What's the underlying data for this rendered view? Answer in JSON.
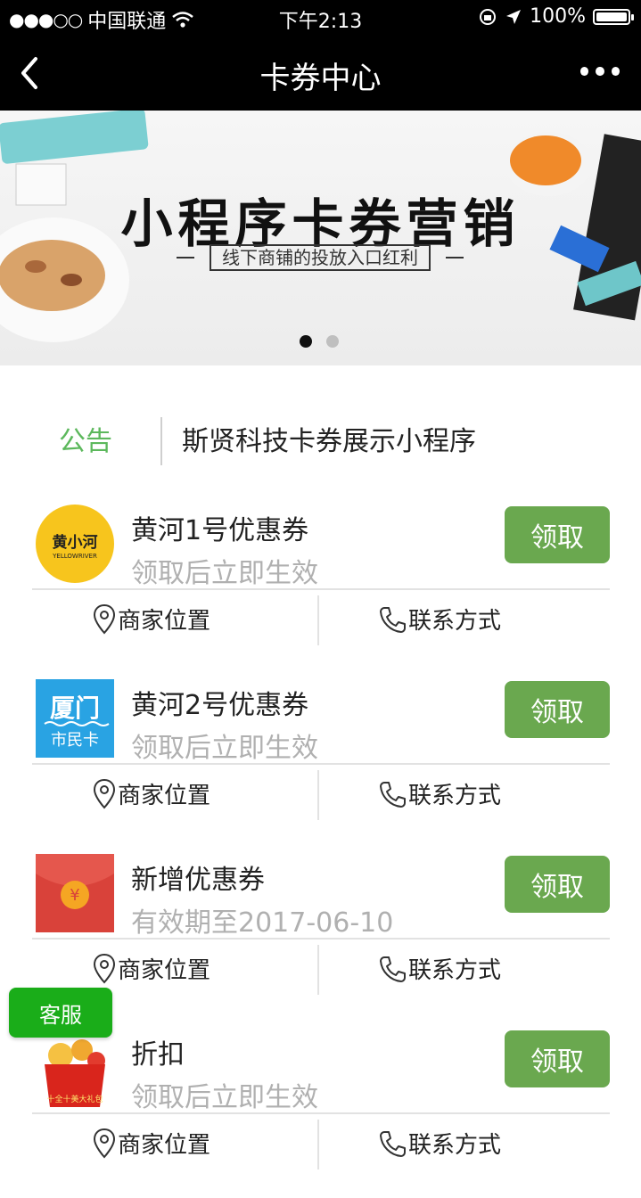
{
  "status_bar": {
    "carrier": "中国联通",
    "signal": "●●●○○",
    "time": "下午2:13",
    "battery": "100%"
  },
  "nav": {
    "title": "卡券中心"
  },
  "banner": {
    "title": "小程序卡券营销",
    "subtitle": "线下商铺的投放入口红利",
    "dots": 2,
    "active_dot": 0
  },
  "notice": {
    "label": "公告",
    "text": "斯贤科技卡券展示小程序"
  },
  "coupons": [
    {
      "name": "黄河1号优惠券",
      "desc": "领取后立即生效",
      "button": "领取",
      "location_label": "商家位置",
      "contact_label": "联系方式",
      "logo": "yellowriver-logo",
      "logo_text": "黄小河",
      "logo_subtext": "YELLOWRIVER"
    },
    {
      "name": "黄河2号优惠券",
      "desc": "领取后立即生效",
      "button": "领取",
      "location_label": "商家位置",
      "contact_label": "联系方式",
      "logo": "xiamen-card-logo",
      "logo_text": "厦门",
      "logo_subtext": "市民卡"
    },
    {
      "name": "新增优惠券",
      "desc": "有效期至2017-06-10",
      "button": "领取",
      "location_label": "商家位置",
      "contact_label": "联系方式",
      "logo": "red-envelope-logo",
      "logo_text": "¥",
      "logo_subtext": ""
    },
    {
      "name": "折扣",
      "desc": "领取后立即生效",
      "button": "领取",
      "location_label": "商家位置",
      "contact_label": "联系方式",
      "logo": "gift-bag-logo",
      "logo_text": "",
      "logo_subtext": "十全十美大礼包"
    }
  ],
  "service_button": "客服",
  "colors": {
    "accent_green": "#6aa84f",
    "service_green": "#1aad19",
    "notice_green": "#5cb85c",
    "bar_black": "#000000"
  }
}
